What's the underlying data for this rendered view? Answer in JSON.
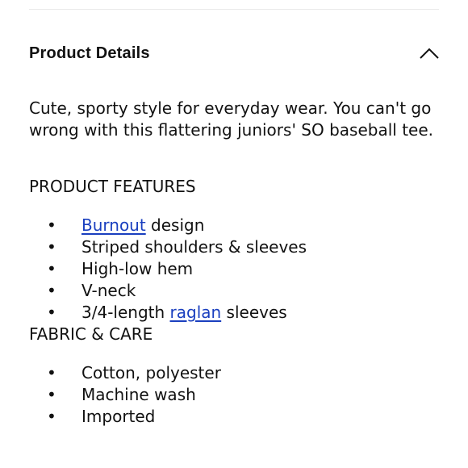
{
  "header": {
    "title": "Product Details",
    "toggle_icon": "chevron-up-icon"
  },
  "description": "Cute, sporty style for everyday wear. You can't go wrong with this flattering juniors' SO baseball tee.",
  "features": {
    "heading": "PRODUCT FEATURES",
    "items": [
      {
        "link": "Burnout",
        "after": " design"
      },
      {
        "text": "Striped shoulders & sleeves"
      },
      {
        "text": "High-low hem"
      },
      {
        "text": "V-neck"
      },
      {
        "before": "3/4-length ",
        "link": "raglan",
        "after": " sleeves"
      }
    ]
  },
  "fabric_care": {
    "heading": "FABRIC & CARE",
    "items": [
      "Cotton, polyester",
      "Machine wash",
      "Imported"
    ]
  },
  "bullet_glyph": "•",
  "colors": {
    "text": "#111111",
    "link": "#1a3fbf",
    "divider": "#e9e9e9"
  }
}
